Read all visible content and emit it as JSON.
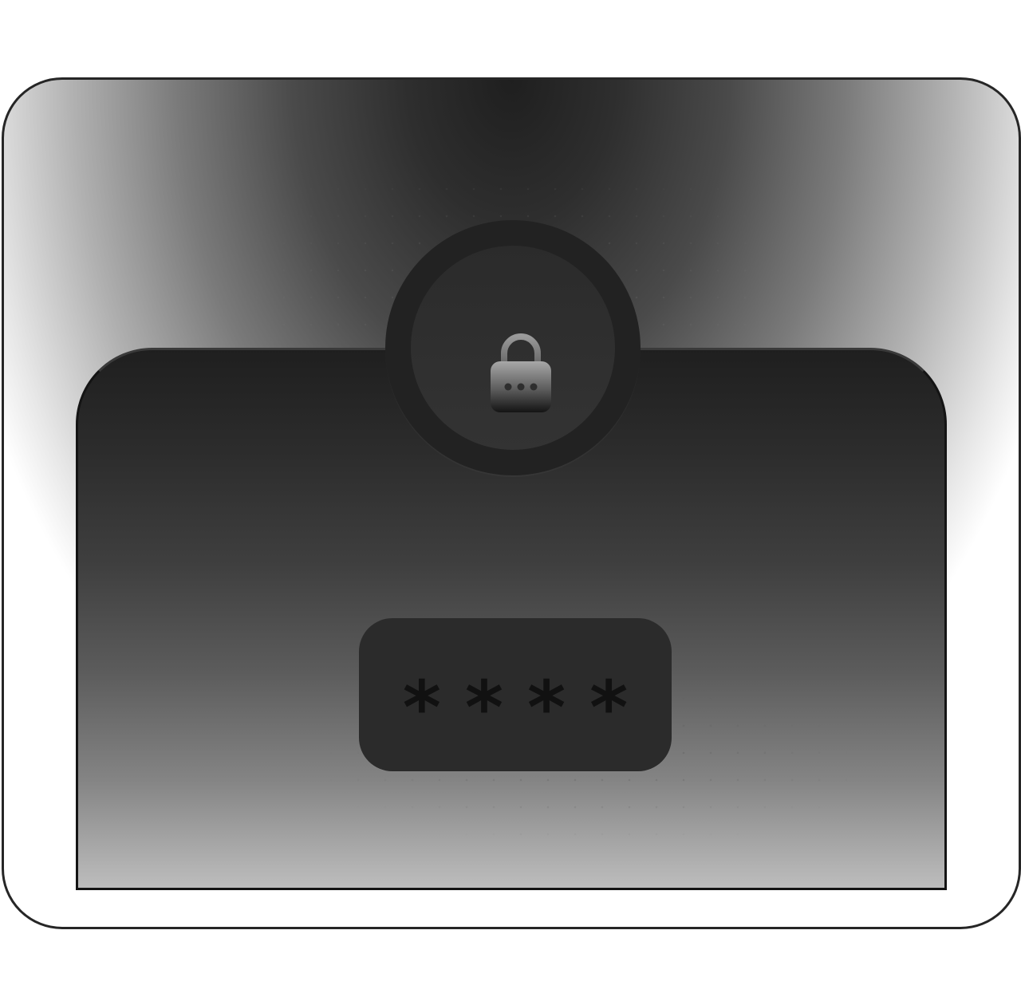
{
  "lock": {
    "icon": "lock-icon"
  },
  "passcode": {
    "masked_value": "****"
  },
  "colors": {
    "frame_border": "#262626",
    "panel_top": "#1f1f1f",
    "panel_bottom": "#bdbdbd",
    "code_box": "#2b2b2b",
    "code_text": "#111111"
  }
}
